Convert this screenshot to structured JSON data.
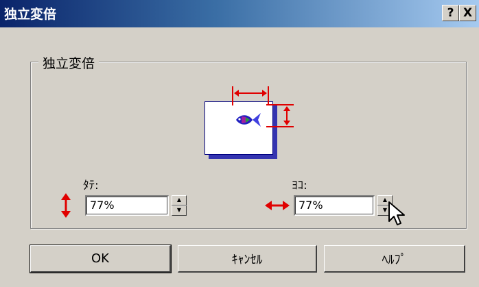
{
  "window": {
    "title": "独立変倍",
    "help_button": "?",
    "close_button": "X"
  },
  "group": {
    "label": "独立変倍"
  },
  "vertical": {
    "label": "ﾀﾃ:",
    "value": "77%",
    "icon": "vertical-resize-arrow-icon"
  },
  "horizontal": {
    "label": "ﾖｺ:",
    "value": "77%",
    "icon": "horizontal-resize-arrow-icon"
  },
  "buttons": {
    "ok": "OK",
    "cancel": "ｷｬﾝｾﾙ",
    "help": "ﾍﾙﾌﾟ"
  },
  "colors": {
    "title_gradient_start": "#0a246a",
    "title_gradient_end": "#a6caf0",
    "arrow_red": "#e00000",
    "dialog_face": "#d4d0c8"
  }
}
